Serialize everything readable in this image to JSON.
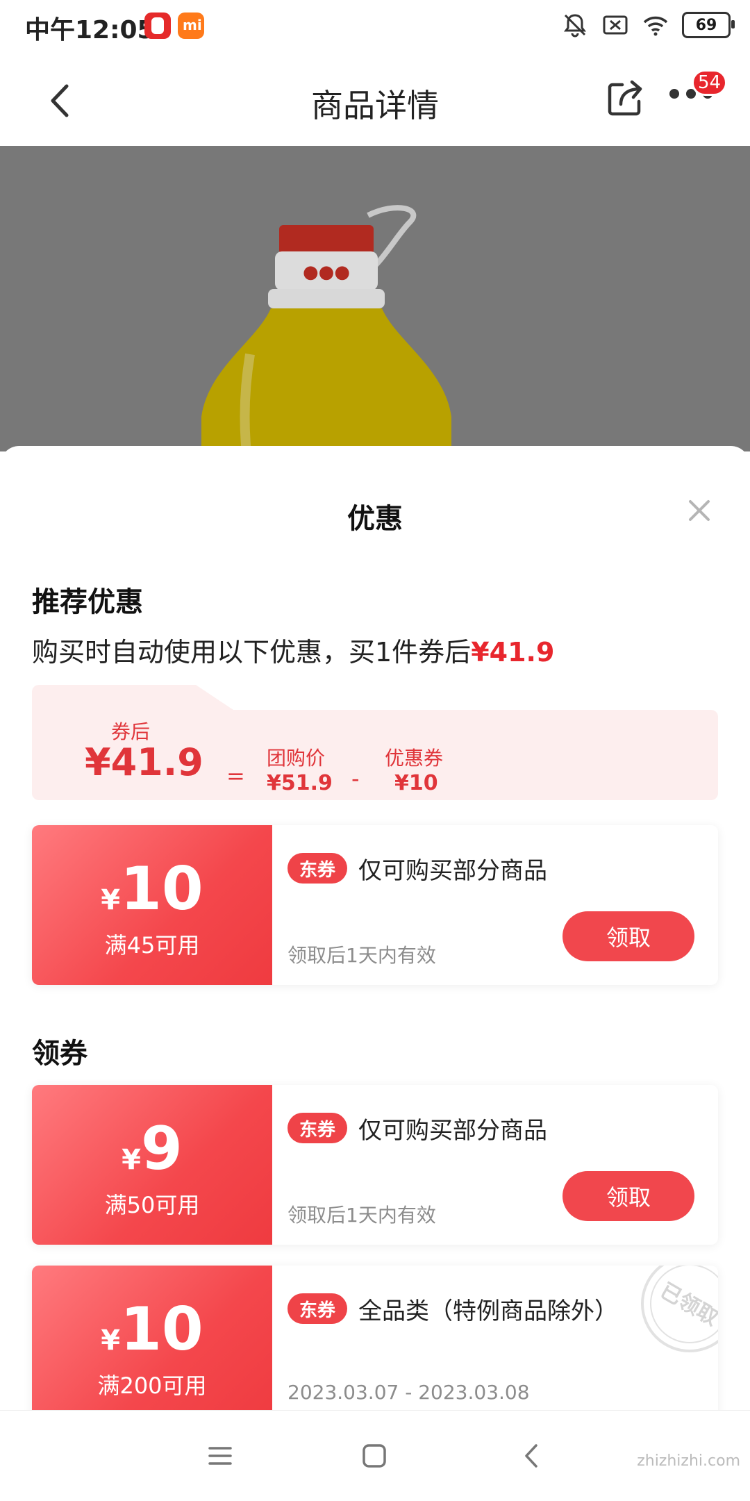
{
  "status_bar": {
    "time": "中午12:05",
    "battery": "69"
  },
  "header": {
    "title": "商品详情",
    "badge_count": "54"
  },
  "sheet": {
    "title": "优惠",
    "recommended": {
      "title": "推荐优惠",
      "auto_text": "购买时自动使用以下优惠，买1件券后",
      "auto_price": "¥41.9",
      "after_label": "券后",
      "after_value": "¥41.9",
      "equals": "=",
      "group_label": "团购价",
      "group_value": "¥51.9",
      "minus": "-",
      "coupon_label": "优惠券",
      "coupon_value": "¥10"
    },
    "claim_section_title": "领券",
    "coupons": [
      {
        "yen": "¥",
        "amount": "10",
        "condition": "满45可用",
        "tag": "东券",
        "scope": "仅可购买部分商品",
        "validity": "领取后1天内有效",
        "button": "领取"
      },
      {
        "yen": "¥",
        "amount": "9",
        "condition": "满50可用",
        "tag": "东券",
        "scope": "仅可购买部分商品",
        "validity": "领取后1天内有效",
        "button": "领取"
      },
      {
        "yen": "¥",
        "amount": "10",
        "condition": "满200可用",
        "tag": "东券",
        "scope": "全品类（特例商品除外）",
        "validity": "2023.03.07 - 2023.03.08",
        "stamp": "已领取"
      }
    ]
  },
  "watermark": "zhizhizhi.com",
  "colors": {
    "accent": "#e8262d",
    "coupon_gradient_start": "#ff7a7e",
    "coupon_gradient_end": "#ef3b40",
    "calc_bg": "#fdeeee"
  }
}
